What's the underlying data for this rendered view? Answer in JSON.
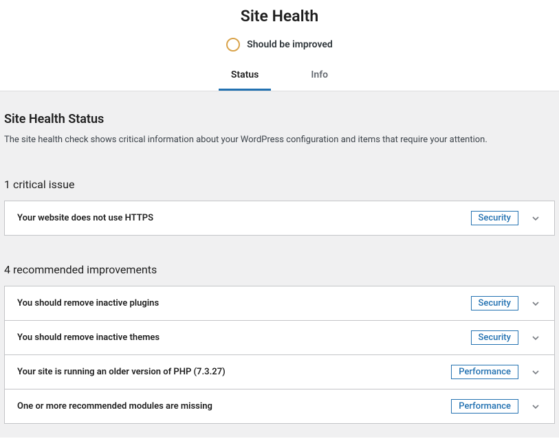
{
  "header": {
    "title": "Site Health",
    "status_label": "Should be improved",
    "tabs": [
      {
        "label": "Status",
        "active": true
      },
      {
        "label": "Info",
        "active": false
      }
    ]
  },
  "main": {
    "heading": "Site Health Status",
    "description": "The site health check shows critical information about your WordPress configuration and items that require your attention.",
    "groups": [
      {
        "heading": "1 critical issue",
        "issues": [
          {
            "title": "Your website does not use HTTPS",
            "badge": "Security"
          }
        ]
      },
      {
        "heading": "4 recommended improvements",
        "issues": [
          {
            "title": "You should remove inactive plugins",
            "badge": "Security"
          },
          {
            "title": "You should remove inactive themes",
            "badge": "Security"
          },
          {
            "title": "Your site is running an older version of PHP (7.3.27)",
            "badge": "Performance"
          },
          {
            "title": "One or more recommended modules are missing",
            "badge": "Performance"
          }
        ]
      }
    ]
  }
}
